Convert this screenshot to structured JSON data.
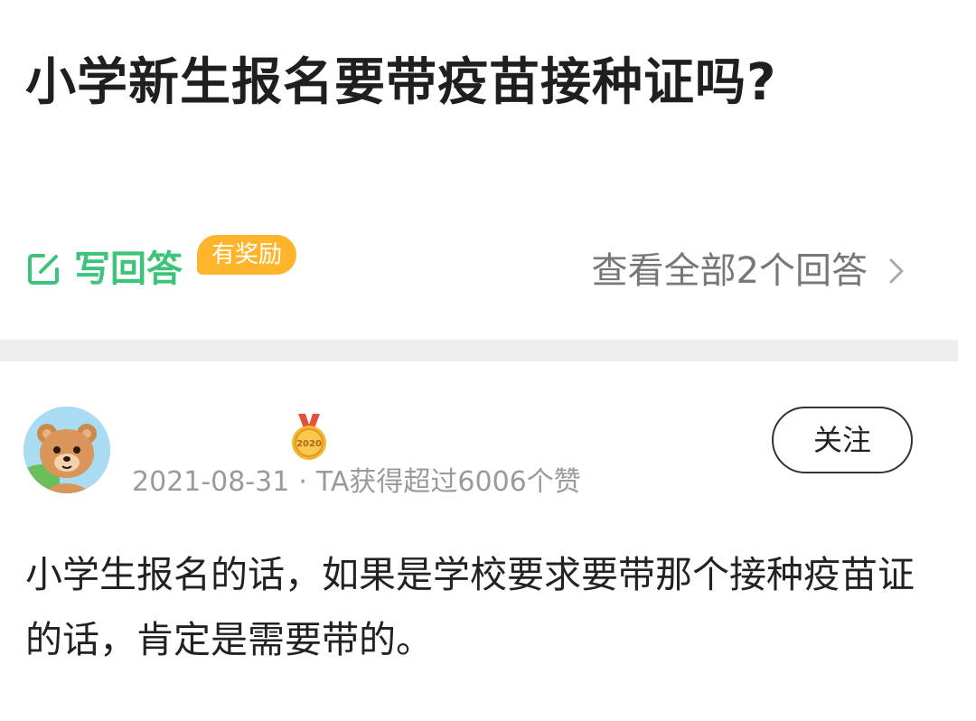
{
  "question": {
    "title": "小学新生报名要带疫苗接种证吗?"
  },
  "actions": {
    "write_answer_label": "写回答",
    "reward_badge": "有奖励",
    "view_all_label": "查看全部2个回答",
    "edit_icon": "edit-icon",
    "chevron_icon": "chevron-right-icon"
  },
  "answer": {
    "medal_year": "2020",
    "follow_label": "关注",
    "date": "2021-08-31",
    "separator": "·",
    "likes_text": "TA获得超过6006个赞",
    "content": "小学生报名的话，如果是学校要求要带那个接种疫苗证的话，肯定是需要带的。"
  },
  "colors": {
    "accent_green": "#3ec47a",
    "badge_orange": "#ffb52b",
    "meta_gray": "#9a9a9a",
    "divider_gray": "#eeeeee"
  }
}
